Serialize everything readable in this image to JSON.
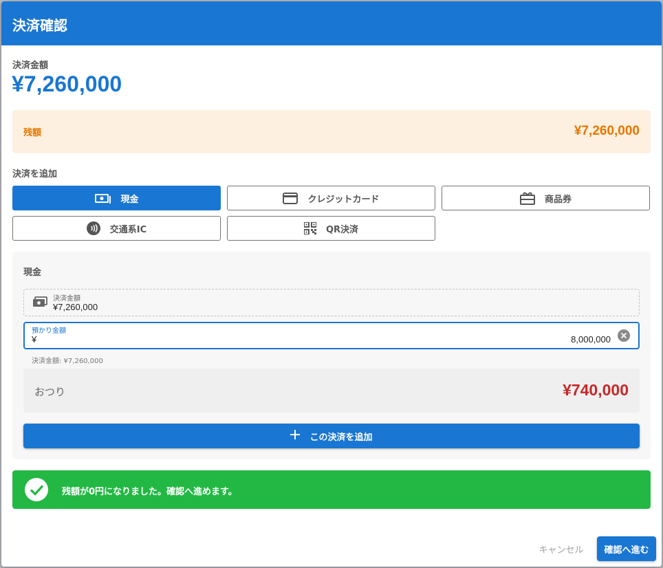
{
  "dialog": {
    "title": "決済確認"
  },
  "summary": {
    "amount_label": "決済金額",
    "amount_value": "¥7,260,000"
  },
  "remaining": {
    "label": "残額",
    "value": "¥7,260,000"
  },
  "add_section": {
    "title": "決済を追加",
    "methods": [
      {
        "label": "現金",
        "icon": "cash-icon",
        "selected": true
      },
      {
        "label": "クレジットカード",
        "icon": "credit-card-icon",
        "selected": false
      },
      {
        "label": "商品券",
        "icon": "gift-card-icon",
        "selected": false
      },
      {
        "label": "交通系IC",
        "icon": "contactless-icon",
        "selected": false
      },
      {
        "label": "QR決済",
        "icon": "qr-code-icon",
        "selected": false
      }
    ]
  },
  "cash_panel": {
    "title": "現金",
    "payment_field": {
      "label": "決済金額",
      "value": "¥7,260,000",
      "icon": "cash-icon"
    },
    "received_field": {
      "label": "預かり金額",
      "prefix": "¥",
      "value": "8,000,000"
    },
    "helper": "決済金額: ¥7,260,000",
    "change": {
      "label": "おつり",
      "value": "¥740,000"
    },
    "add_button": "この決済を追加"
  },
  "success": {
    "message": "残額が0円になりました。確認へ進めます。"
  },
  "footer": {
    "cancel": "キャンセル",
    "confirm": "確認へ進む"
  },
  "colors": {
    "primary": "#1976d2",
    "warning": "#e67700",
    "success": "#22b843",
    "danger": "#c62828"
  }
}
